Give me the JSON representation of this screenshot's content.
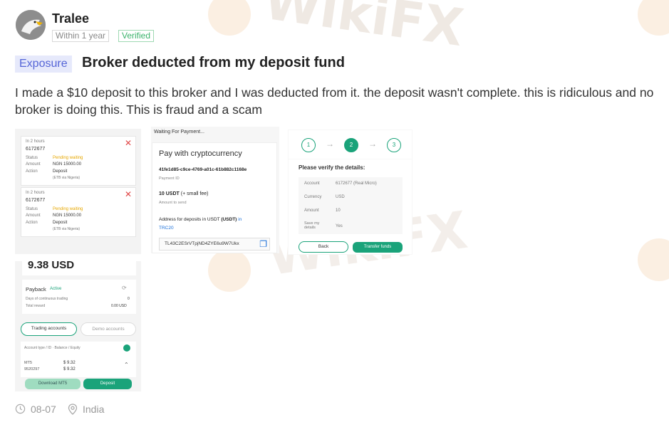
{
  "user": {
    "name": "Tralee",
    "tenure": "Within 1 year",
    "verified": "Verified"
  },
  "post": {
    "category": "Exposure",
    "title": "Broker deducted from my deposit fund",
    "body": "I made a $10 deposit to this broker and I was deducted from it. the deposit wasn't complete. this is ridiculous and no broker is doing this. This is fraud and a scam",
    "date": "08-07",
    "location": "India"
  },
  "thumb1": {
    "card1": {
      "time": "In 2 hours",
      "id": "6172677",
      "status_label": "Status",
      "status": "Pending waiting",
      "amount_label": "Amount",
      "amount": "NGN 15000.00",
      "action_label": "Action",
      "action": "Deposit",
      "method": "(ETB via Nigeria)"
    },
    "card2": {
      "time": "In 2 hours",
      "id": "6172677",
      "status_label": "Status",
      "status": "Pending waiting",
      "amount_label": "Amount",
      "amount": "NGN 15000.00",
      "action_label": "Action",
      "action": "Deposit",
      "method": "(ETB via Nigeria)"
    }
  },
  "thumb2": {
    "header": "Waiting For Payment...",
    "heading": "Pay with cryptocurrency",
    "payment_id": "41fe1d85-c9ce-4769-a01c-61b882c1168e",
    "payment_id_label": "Payment ID",
    "amount": "10 USDT",
    "amount_note": "(+ small fee)",
    "amount_label": "Amount to send",
    "address_label": "Address for deposits in USDT",
    "address_bold": "(USDT)",
    "network_in": "in",
    "network": "TRC20",
    "address": "TL43C2ESrVTpjND4ZYE6u9W7Ukx"
  },
  "thumb3": {
    "steps": [
      "1",
      "2",
      "3"
    ],
    "heading": "Please verify the details:",
    "rows": [
      {
        "label": "Account",
        "value": "6172677 (Real Micro)"
      },
      {
        "label": "Currency",
        "value": "USD"
      },
      {
        "label": "Amount",
        "value": "10"
      },
      {
        "label": "Save my details",
        "value": "Yes"
      }
    ],
    "back": "Back",
    "transfer": "Transfer funds"
  },
  "thumb4": {
    "balance": "9.38 USD",
    "payback": "Payback",
    "payback_status": "Active",
    "days_label": "Days of continuous trading",
    "days_value": "0",
    "reward_label": "Total reward",
    "reward_value": "0.00 USD",
    "tab_trading": "Trading accounts",
    "tab_demo": "Demo accounts",
    "list_header": "Account type / ID · Balance / Equity",
    "acct_type": "MT5",
    "acct_id": "9520297",
    "acct_balance": "$ 9.32",
    "acct_equity": "$ 9.32",
    "download": "Download MT5",
    "deposit": "Deposit"
  },
  "watermark": "WikiFX",
  "colors": {
    "accent_green": "#1aa37a",
    "exposure_bg": "#e6e9fb",
    "exposure_text": "#5565d7",
    "verified": "#3bb36b"
  }
}
